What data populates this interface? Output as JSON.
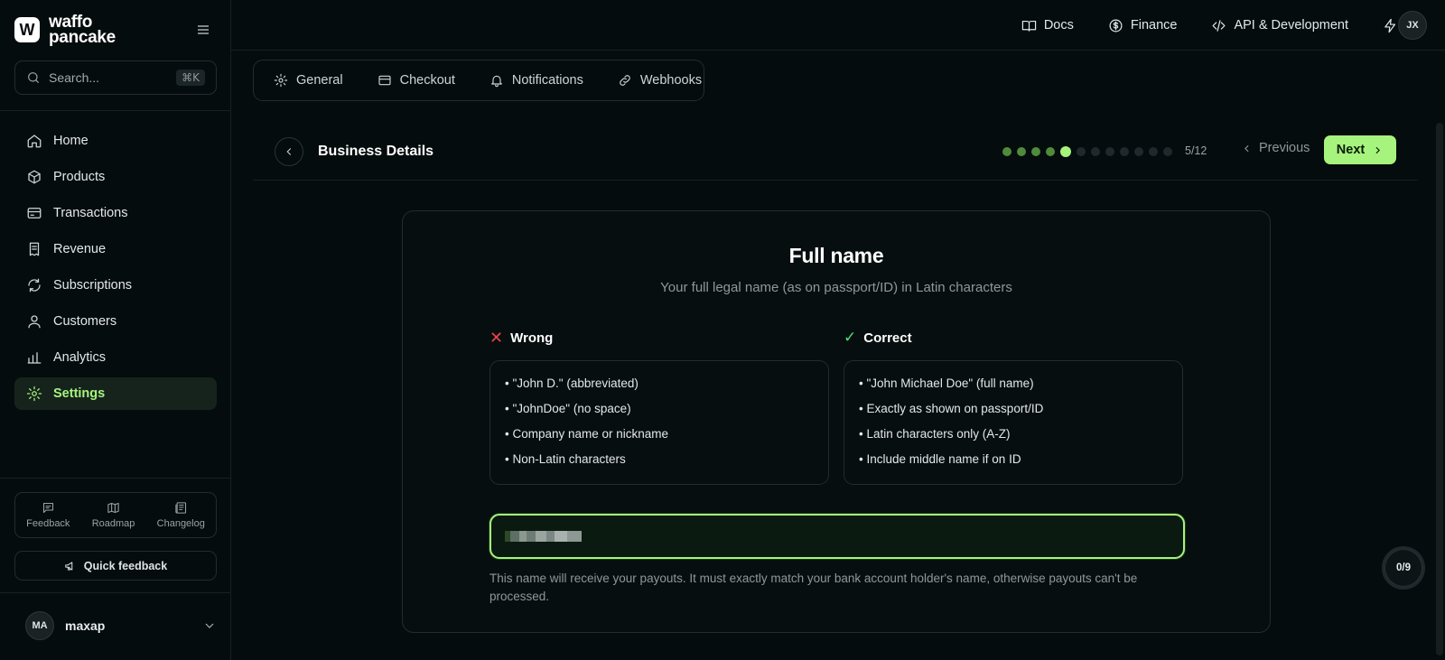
{
  "brand": {
    "line1": "waffo",
    "line2": "pancake",
    "mark": "W"
  },
  "search": {
    "placeholder": "Search...",
    "shortcut": "⌘K"
  },
  "nav": [
    {
      "label": "Home",
      "icon": "home-icon",
      "active": false
    },
    {
      "label": "Products",
      "icon": "box-icon",
      "active": false
    },
    {
      "label": "Transactions",
      "icon": "credit-card-icon",
      "active": false
    },
    {
      "label": "Revenue",
      "icon": "receipt-icon",
      "active": false
    },
    {
      "label": "Subscriptions",
      "icon": "refresh-icon",
      "active": false
    },
    {
      "label": "Customers",
      "icon": "user-icon",
      "active": false
    },
    {
      "label": "Analytics",
      "icon": "bar-chart-icon",
      "active": false
    },
    {
      "label": "Settings",
      "icon": "gear-icon",
      "active": true
    }
  ],
  "quick_links": [
    {
      "label": "Feedback",
      "icon": "message-icon"
    },
    {
      "label": "Roadmap",
      "icon": "map-icon"
    },
    {
      "label": "Changelog",
      "icon": "newspaper-icon"
    }
  ],
  "quick_feedback_label": "Quick feedback",
  "user": {
    "initials": "MA",
    "name": "maxap"
  },
  "topbar": {
    "links": [
      {
        "label": "Docs",
        "icon": "book-icon"
      },
      {
        "label": "Finance",
        "icon": "dollar-circle-icon"
      },
      {
        "label": "API & Development",
        "icon": "code-icon"
      }
    ],
    "avatar_initials": "JX"
  },
  "tabs": [
    {
      "label": "General",
      "icon": "gear-icon"
    },
    {
      "label": "Checkout",
      "icon": "credit-card-icon"
    },
    {
      "label": "Notifications",
      "icon": "bell-icon"
    },
    {
      "label": "Webhooks",
      "icon": "link-icon"
    }
  ],
  "step": {
    "title": "Business Details",
    "current": 5,
    "total": 12,
    "counter": "5/12",
    "previous_label": "Previous",
    "next_label": "Next"
  },
  "card": {
    "title": "Full name",
    "subtitle": "Your full legal name (as on passport/ID) in Latin characters",
    "wrong_heading": "Wrong",
    "correct_heading": "Correct",
    "wrong_items": [
      "• \"John D.\" (abbreviated)",
      "• \"JohnDoe\" (no space)",
      "• Company name or nickname",
      "• Non-Latin characters"
    ],
    "correct_items": [
      "• \"John Michael Doe\" (full name)",
      "• Exactly as shown on passport/ID",
      "• Latin characters only (A-Z)",
      "• Include middle name if on ID"
    ],
    "hint": "This name will receive your payouts. It must exactly match your bank account holder's name, otherwise payouts can't be processed."
  },
  "progress_badge": "0/9",
  "colors": {
    "accent": "#a6f47d",
    "wrong": "#ef4444",
    "correct": "#4ade80",
    "background": "#050c0d"
  }
}
